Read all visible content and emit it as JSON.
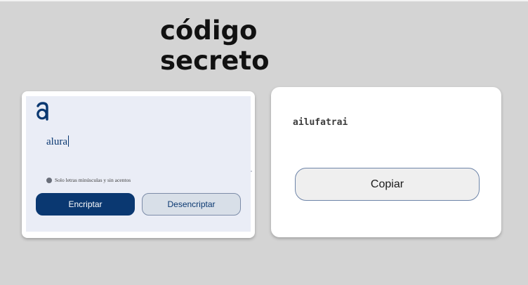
{
  "header": {
    "title_line1": "código",
    "title_line2": "secreto"
  },
  "encrypt_panel": {
    "logo_icon": "alura-logo-icon",
    "input_value": "alura",
    "info_icon": "info-icon",
    "info_text": "Solo letras minúsculas y sin acentos",
    "encrypt_label": "Encriptar",
    "decrypt_label": "Desencriptar"
  },
  "output_panel": {
    "result_text": "ailufatrai",
    "copy_label": "Copiar"
  },
  "colors": {
    "background": "#d4d4d4",
    "primary": "#0a3871",
    "panel": "#eaedf6",
    "secondary_button": "#d8dfe8"
  }
}
